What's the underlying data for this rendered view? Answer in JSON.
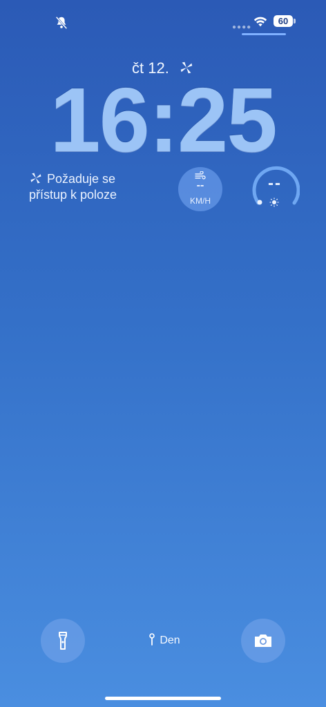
{
  "status_bar": {
    "battery_level": "60",
    "icons": [
      "bell-slash-icon",
      "signal-dots-icon",
      "wifi-icon",
      "battery-icon"
    ]
  },
  "lock_screen": {
    "date": "čt 12.",
    "time": "16:25"
  },
  "widgets": {
    "location": {
      "line1": "Požaduje se",
      "line2": "přístup k poloze",
      "icon": "location-fan-icon"
    },
    "wind": {
      "value": "--",
      "unit": "KM/H",
      "icon": "wind-icon"
    },
    "uv": {
      "value": "--",
      "icon": "sun-icon"
    }
  },
  "bottom": {
    "focus_label": "Den",
    "buttons": [
      "flashlight-icon",
      "camera-icon"
    ]
  },
  "colors": {
    "bg_top": "#2b5ab6",
    "bg_bottom": "#4a8ee0",
    "clock": "#9cc4f6"
  }
}
